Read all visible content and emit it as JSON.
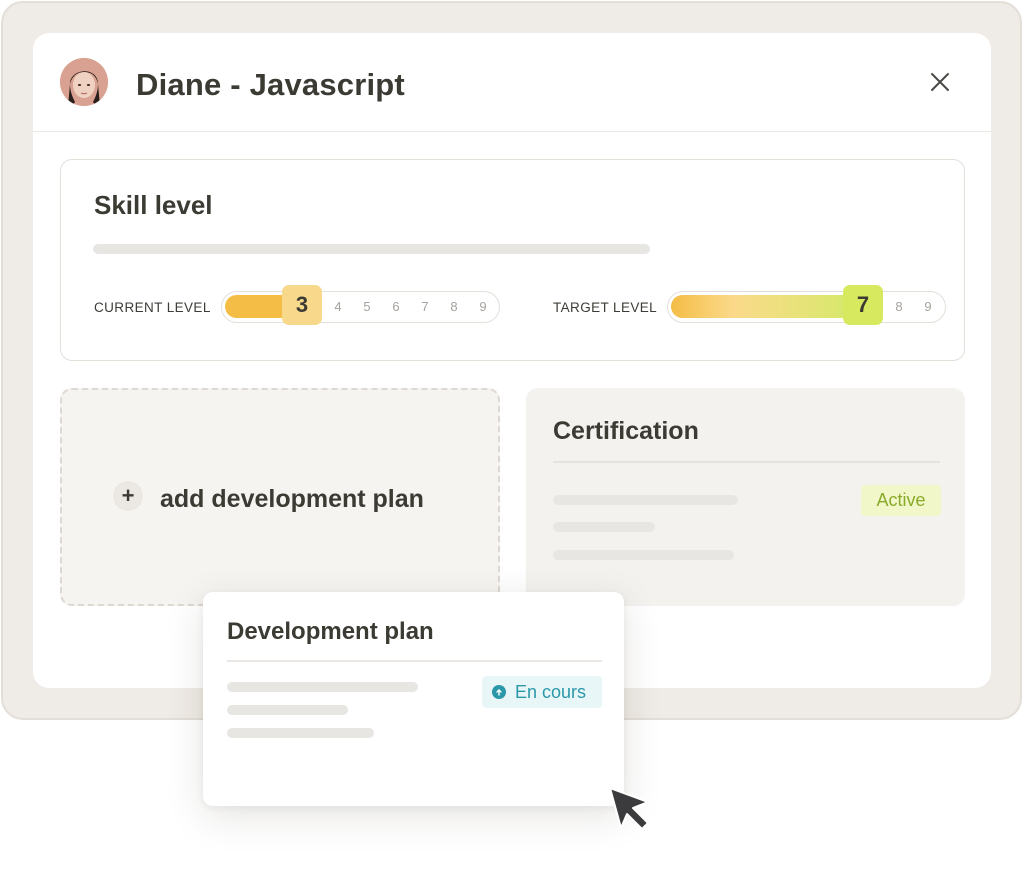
{
  "header": {
    "title": "Diane - Javascript"
  },
  "skill": {
    "title": "Skill level",
    "current": {
      "label": "CURRENT LEVEL",
      "value": "3",
      "ticks": [
        "4",
        "5",
        "6",
        "7",
        "8",
        "9"
      ]
    },
    "target": {
      "label": "TARGET LEVEL",
      "value": "7",
      "ticks": [
        "8",
        "9"
      ]
    }
  },
  "add_plan": {
    "icon": "plus-icon",
    "label": "add development plan"
  },
  "certification": {
    "title": "Certification",
    "status": "Active"
  },
  "development_plan": {
    "title": "Development plan",
    "status": "En cours"
  },
  "colors": {
    "frame": "#efebe6",
    "current_fill": "#f4bd45",
    "current_knob": "#f8d98c",
    "target_fill_start": "#f4bd45",
    "target_fill_end": "#d7e86c",
    "target_knob": "#d6e95f",
    "active_badge": "#f1f7c8",
    "encours_badge": "#e9f6f7",
    "encours_accent": "#2a98a8"
  }
}
